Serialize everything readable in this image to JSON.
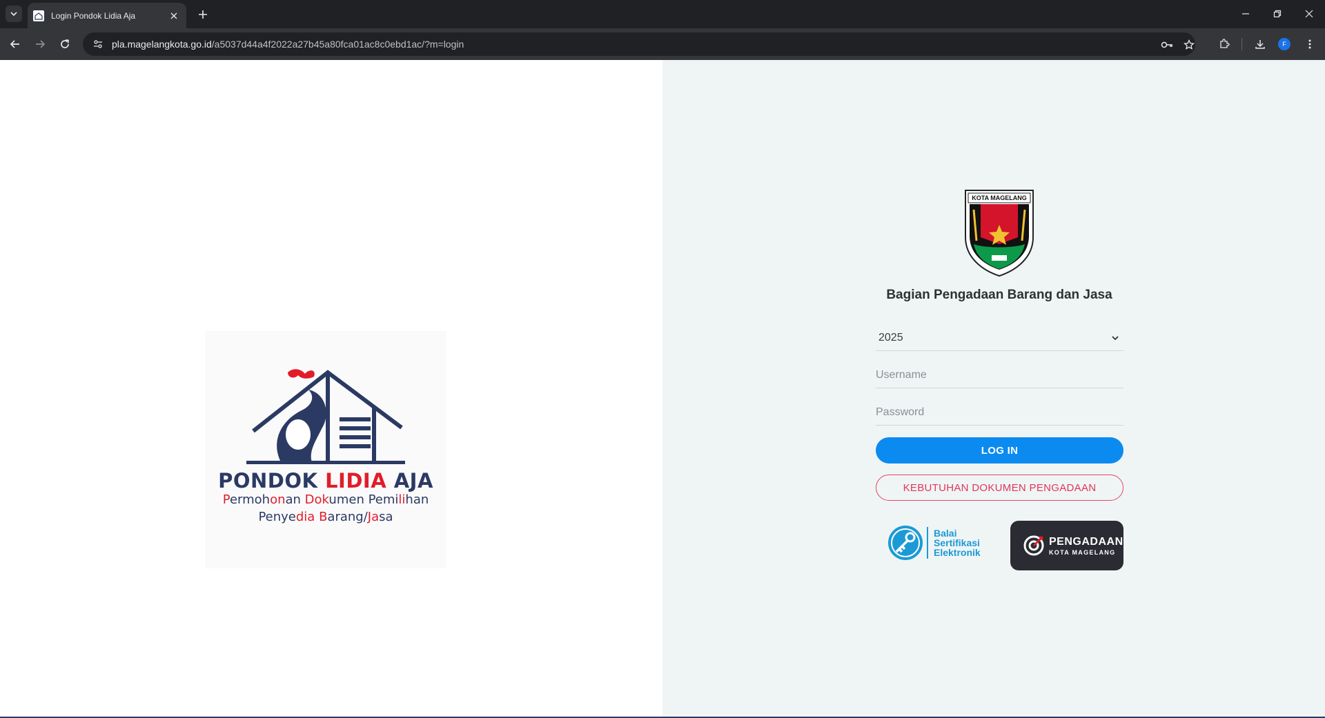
{
  "browser": {
    "tab_title": "Login Pondok Lidia Aja",
    "url_host": "pla.magelangkota.go.id",
    "url_path": "/a5037d44a4f2022a27b45a80fca01ac8c0ebd1ac/?m=login",
    "profile_initial": "F"
  },
  "brand": {
    "name_part1": "PONDOK ",
    "name_part2": "LIDIA",
    "name_part3": " AJA",
    "tag_line1_a": "P",
    "tag_line1_b": "ermoh",
    "tag_line1_c": "on",
    "tag_line1_d": "an ",
    "tag_line1_e": "D",
    "tag_line1_f": "ok",
    "tag_line1_g": "umen Pemi",
    "tag_line1_h": "li",
    "tag_line1_i": "han",
    "tag_line2_a": "Penye",
    "tag_line2_b": "dia",
    "tag_line2_c": " B",
    "tag_line2_d": "arang/",
    "tag_line2_e": "Ja",
    "tag_line2_f": "sa"
  },
  "login": {
    "crest_caption": "KOTA MAGELANG",
    "org_title": "Bagian Pengadaan Barang dan Jasa",
    "year_selected": "2025",
    "username_placeholder": "Username",
    "password_placeholder": "Password",
    "login_label": "LOG IN",
    "docs_label": "KEBUTUHAN DOKUMEN PENGADAAN"
  },
  "partners": {
    "bsre_line1": "Balai",
    "bsre_line2": "Sertifikasi",
    "bsre_line3": "Elektronik",
    "pengadaan_line1": "PENGADAAN",
    "pengadaan_line2": "KOTA MAGELANG"
  },
  "colors": {
    "accent_blue": "#0b8bf0",
    "accent_red": "#e11d2a",
    "brand_navy": "#2b3a63"
  }
}
